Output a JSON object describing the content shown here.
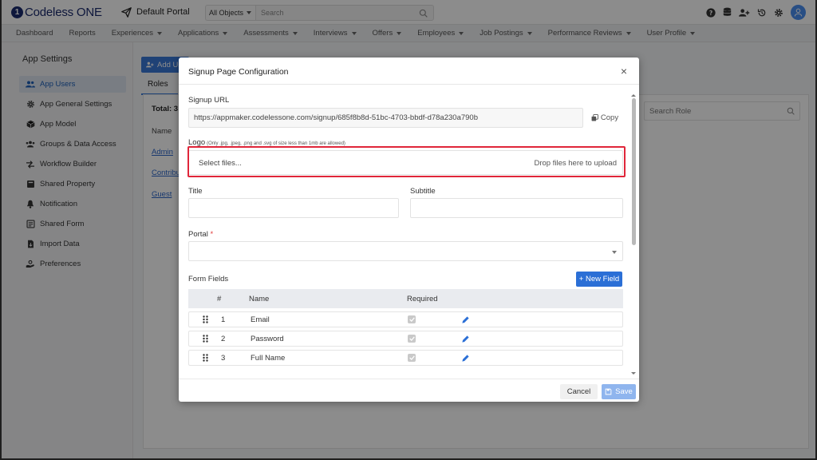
{
  "app": {
    "logo_text": "Codeless ONE",
    "logo_mark": "1",
    "portal_name": "Default Portal"
  },
  "search": {
    "scope": "All Objects",
    "placeholder": "Search"
  },
  "nav": {
    "items": [
      "Dashboard",
      "Reports",
      "Experiences",
      "Applications",
      "Assessments",
      "Interviews",
      "Offers",
      "Employees",
      "Job Postings",
      "Performance Reviews",
      "User Profile"
    ]
  },
  "sidebar": {
    "title": "App Settings",
    "items": [
      {
        "label": "App Users",
        "icon": "users-icon"
      },
      {
        "label": "App General Settings",
        "icon": "gear-icon"
      },
      {
        "label": "App Model",
        "icon": "cube-icon"
      },
      {
        "label": "Groups & Data Access",
        "icon": "group-icon"
      },
      {
        "label": "Workflow Builder",
        "icon": "workflow-icon"
      },
      {
        "label": "Shared Property",
        "icon": "folder-icon"
      },
      {
        "label": "Notification",
        "icon": "bell-icon"
      },
      {
        "label": "Shared Form",
        "icon": "form-icon"
      },
      {
        "label": "Import Data",
        "icon": "import-icon"
      },
      {
        "label": "Preferences",
        "icon": "preferences-icon"
      }
    ]
  },
  "background": {
    "add_label": "Add Us",
    "tab": "Roles",
    "total": "Total: 3",
    "name_header": "Name",
    "roles": [
      "Admin",
      "Contribut",
      "Guest"
    ],
    "search_placeholder": "Search Role"
  },
  "modal": {
    "title": "Signup Page Configuration",
    "close": "×",
    "signup_url_label": "Signup URL",
    "signup_url": "https://appmaker.codelessone.com/signup/685f8b8d-51bc-4703-bbdf-d78a230a790b",
    "copy_label": "Copy",
    "logo_label": "Logo",
    "logo_hint": "(Only .jpg, .jpeg, .png and .svg of size less than 1mb are allowed)",
    "select_files": "Select files...",
    "drop_files": "Drop files here to upload",
    "title_label": "Title",
    "subtitle_label": "Subtitle",
    "portal_label": "Portal",
    "required_mark": "*",
    "form_fields_label": "Form Fields",
    "new_field_label": "+ New Field",
    "grid_headers": {
      "num": "#",
      "name": "Name",
      "required": "Required"
    },
    "fields": [
      {
        "num": "1",
        "name": "Email",
        "required": true
      },
      {
        "num": "2",
        "name": "Password",
        "required": true
      },
      {
        "num": "3",
        "name": "Full Name",
        "required": true
      }
    ],
    "cancel_label": "Cancel",
    "save_label": "Save"
  },
  "colors": {
    "primary": "#2b6fd6",
    "highlight": "#e0263a",
    "brand": "#1a2b6d"
  }
}
